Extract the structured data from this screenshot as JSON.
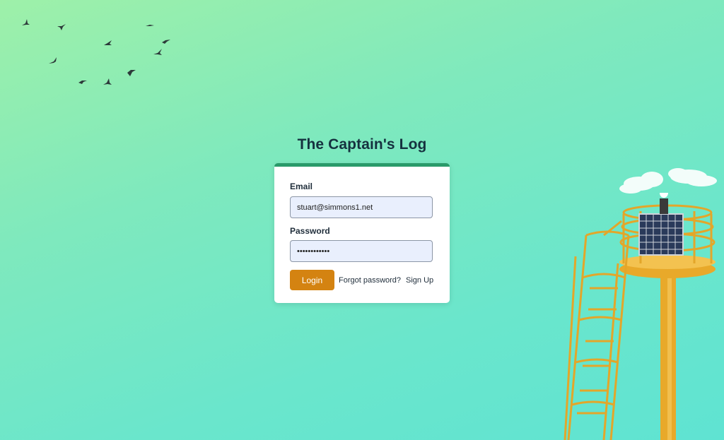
{
  "app": {
    "title": "The Captain's Log"
  },
  "form": {
    "email_label": "Email",
    "email_value": "stuart@simmons1.net",
    "password_label": "Password",
    "password_value": "stuartsimmo1",
    "login_label": "Login",
    "forgot_label": "Forgot password?",
    "signup_label": "Sign Up"
  },
  "colors": {
    "accent": "#2a9a6a",
    "button": "#d48311",
    "input_bg": "#e9effd",
    "title": "#15313f"
  },
  "icons": [
    "bird-icon",
    "lighthouse-tower-image"
  ]
}
